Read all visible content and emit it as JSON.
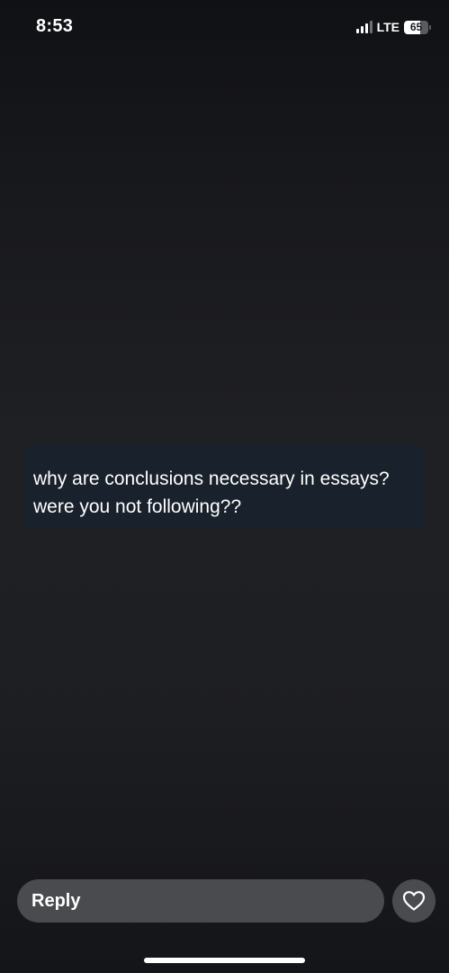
{
  "status_bar": {
    "time": "8:53",
    "network": "LTE",
    "battery_level": "65",
    "battery_fraction": 0.65,
    "signal_bars_active": 3,
    "signal_bars_total": 4
  },
  "message": {
    "line1": "why are conclusions necessary in essays?",
    "line2": "were you not following??"
  },
  "reply_bar": {
    "placeholder": "Reply",
    "like_icon": "heart-outline-icon"
  },
  "colors": {
    "background": "#1e1f23",
    "card": "#19212c",
    "pill": "#4a4b4f",
    "text": "#ffffff"
  }
}
